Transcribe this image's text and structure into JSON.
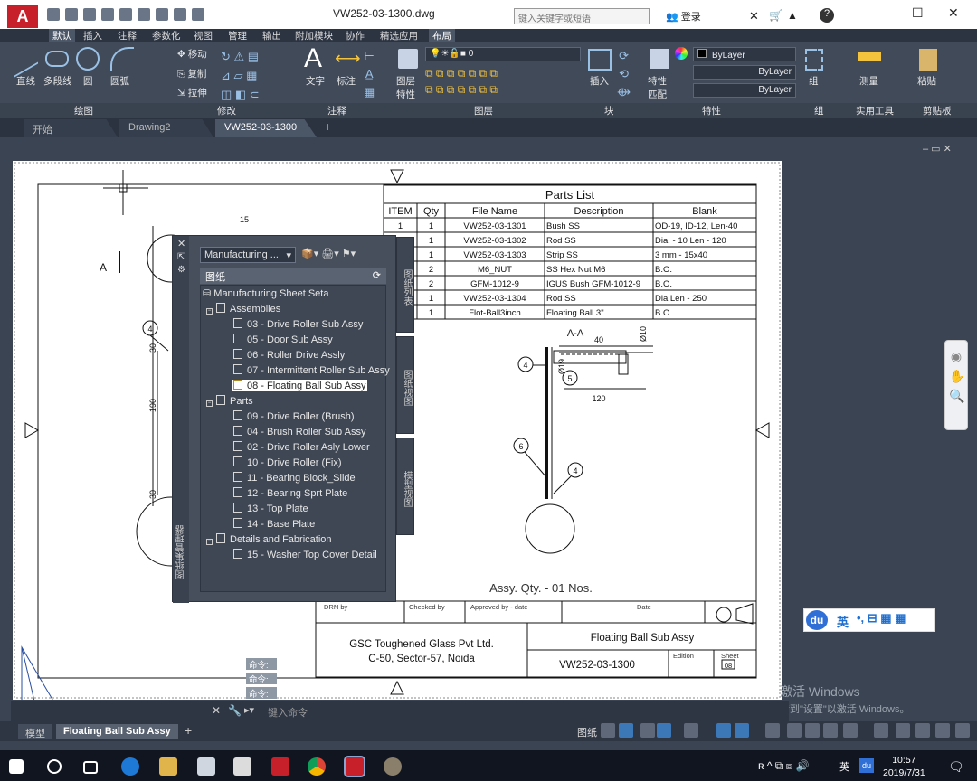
{
  "window": {
    "app_logo": "A",
    "doc_title": "VW252-03-1300.dwg",
    "search_placeholder": "键入关键字或短语",
    "login_label": "登录"
  },
  "ribbon_tabs": [
    "默认",
    "插入",
    "注释",
    "参数化",
    "视图",
    "管理",
    "输出",
    "附加模块",
    "协作",
    "精选应用",
    "布局"
  ],
  "ribbon": {
    "draw_buttons": [
      "直线",
      "多段线",
      "圆",
      "圆弧"
    ],
    "modify_buttons": [
      "移动",
      "复制",
      "拉伸"
    ],
    "text_button": "文字",
    "dim_button": "标注",
    "layer_prop_button": "图层\n特性",
    "layer_combo": "0",
    "insert_button": "插入",
    "match_prop_button": "特性\n匹配",
    "bylayer_color": "ByLayer",
    "bylayer_line1": "ByLayer",
    "bylayer_line2": "ByLayer",
    "group_button": "组",
    "measure_button": "测量",
    "paste_button": "粘贴",
    "groups": [
      "绘图",
      "修改",
      "注释",
      "图层",
      "块",
      "特性",
      "组",
      "实用工具",
      "剪贴板"
    ]
  },
  "doc_tabs": [
    "开始",
    "Drawing2",
    "VW252-03-1300"
  ],
  "sheet_panel": {
    "combo": "Manufacturing ...",
    "header": "图纸",
    "side_title": "图纸集管理器",
    "vtabs": [
      "图纸列表",
      "图纸视图",
      "模型视图"
    ],
    "root": "Manufacturing Sheet Seta",
    "assemblies_label": "Assemblies",
    "assemblies": [
      "03 - Drive Roller Sub Assy",
      "05 - Door Sub Assy",
      "06 - Roller Drive Assly",
      "07 - Intermittent Roller Sub Assy",
      "08 - Floating Ball Sub Assy"
    ],
    "parts_label": "Parts",
    "parts": [
      "09 - Drive Roller (Brush)",
      "04 - Brush Roller Sub Assy",
      "02 - Drive Roller Asly Lower",
      "10 - Drive Roller (Fix)",
      "11 - Bearing Block_Slide",
      "12 - Bearing Sprt Plate",
      "13 - Top Plate",
      "14 - Base Plate"
    ],
    "details_label": "Details and Fabrication",
    "details": [
      "15 - Washer Top Cover Detail"
    ]
  },
  "parts_list": {
    "title": "Parts List",
    "headers": [
      "ITEM",
      "Qty",
      "File Name",
      "Description",
      "Blank"
    ],
    "rows": [
      [
        "1",
        "1",
        "VW252-03-1301",
        "Bush SS",
        "OD-19, ID-12, Len-40"
      ],
      [
        "1",
        "1",
        "VW252-03-1302",
        "Rod SS",
        "Dia. - 10 Len - 120"
      ],
      [
        "1",
        "1",
        "VW252-03-1303",
        "Strip SS",
        "3 mm - 15x40"
      ],
      [
        "2",
        "2",
        "M6_NUT",
        "SS Hex Nut M6",
        "B.O."
      ],
      [
        "2",
        "2",
        "GFM-1012-9",
        "IGUS Bush GFM-1012-9",
        "B.O."
      ],
      [
        "1",
        "1",
        "VW252-03-1304",
        "Rod SS",
        "Dia Len - 250"
      ],
      [
        "1",
        "1",
        "Flot-Ball3inch",
        "Floating Ball 3\"",
        "B.O."
      ]
    ]
  },
  "drawing": {
    "section_label": "A-A",
    "dim_40": "40",
    "dim_10": "Ø10",
    "dim_19": "Ø19",
    "dim_120": "120",
    "dim_15": "15",
    "dim_30a": "30",
    "dim_190": "190",
    "dim_30b": "30",
    "view_label": "A",
    "balloons": [
      "4",
      "5",
      "6",
      "4",
      "4"
    ],
    "assy_qty": "Assy. Qty. - 01 Nos."
  },
  "title_block": {
    "drn_by": "DRN by",
    "checked_by": "Checked by",
    "approved_by": "Approved by - date",
    "date": "Date",
    "company_line1": "GSC Toughened Glass Pvt Ltd.",
    "company_line2": "C-50, Sector-57, Noida",
    "drawing_title": "Floating Ball Sub Assy",
    "drawing_no": "VW252-03-1300",
    "edition": "Edition",
    "sheet_label": "Sheet",
    "sheet_no": "08"
  },
  "command": {
    "history": [
      "命令:",
      "命令:",
      "命令:"
    ],
    "placeholder": "键入命令"
  },
  "layout_tabs": [
    "模型",
    "Floating Ball Sub Assy"
  ],
  "status_label": "图纸",
  "input_bar": {
    "du": "du",
    "lang": "英"
  },
  "watermark": {
    "line1": "激活 Windows",
    "line2": "转到\"设置\"以激活 Windows。"
  },
  "taskbar": {
    "lang": "英",
    "time": "10:57",
    "date": "2019/7/31",
    "du": "du"
  }
}
